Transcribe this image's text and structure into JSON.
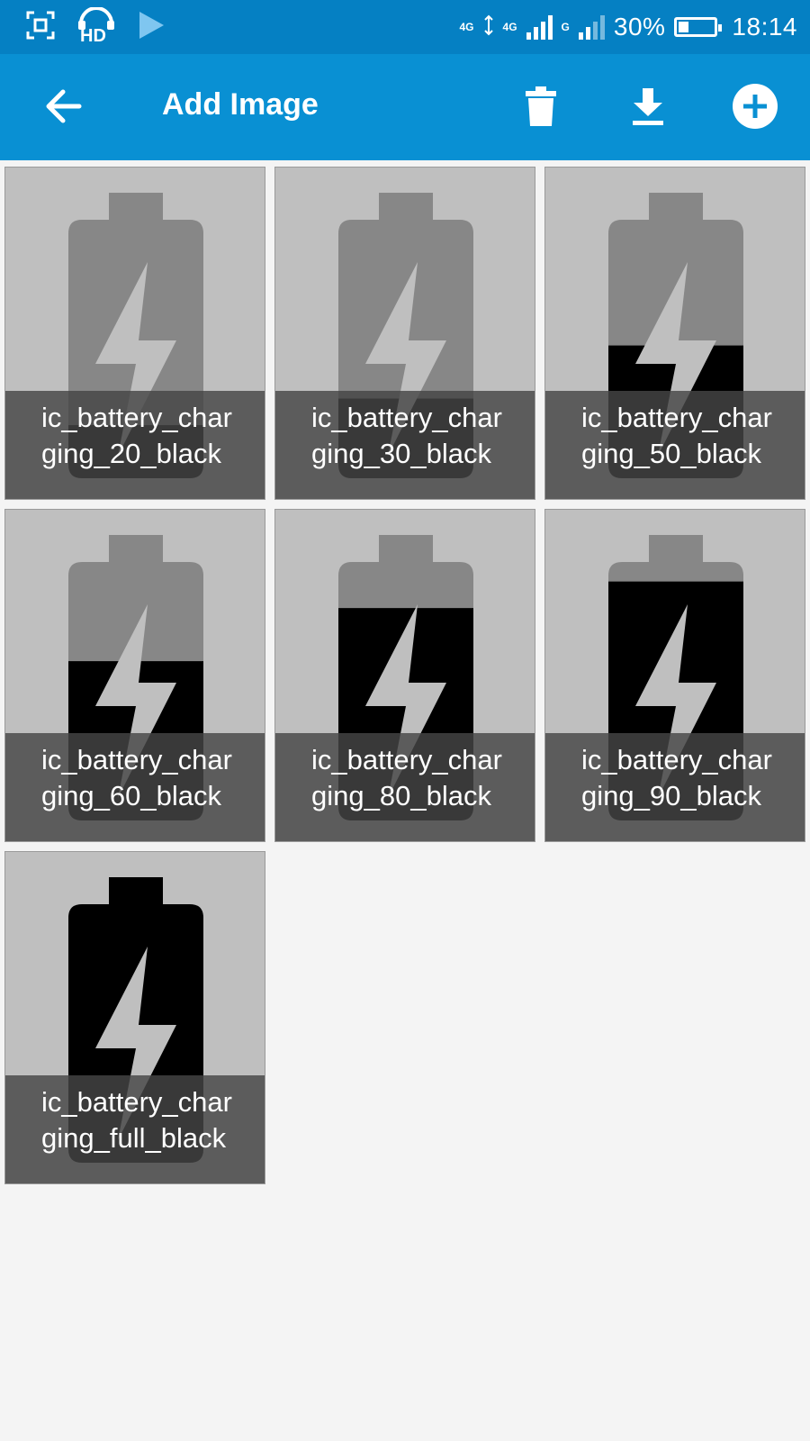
{
  "status_bar": {
    "left_icons": [
      "screenshot-icon",
      "hd-voice-icon",
      "play-store-icon"
    ],
    "network_label_1": "4G",
    "network_label_2": "4G",
    "network_label_3": "G",
    "battery_percent": 30,
    "battery_text": "30%",
    "time": "18:14"
  },
  "app_bar": {
    "title": "Add Image",
    "back_icon": "arrow-back-icon",
    "actions": [
      {
        "name": "delete",
        "icon": "trash-icon"
      },
      {
        "name": "download",
        "icon": "download-icon"
      },
      {
        "name": "add",
        "icon": "add-circle-icon"
      }
    ]
  },
  "images": [
    {
      "label": "ic_battery_charging_20_black",
      "level": 20
    },
    {
      "label": "ic_battery_charging_30_black",
      "level": 30
    },
    {
      "label": "ic_battery_charging_50_black",
      "level": 50
    },
    {
      "label": "ic_battery_charging_60_black",
      "level": 60
    },
    {
      "label": "ic_battery_charging_80_black",
      "level": 80
    },
    {
      "label": "ic_battery_charging_90_black",
      "level": 90
    },
    {
      "label": "ic_battery_charging_full_black",
      "level": 100
    }
  ],
  "colors": {
    "status_bar": "#0580c3",
    "app_bar": "#0990d3",
    "tile_bg": "#bfbfbf",
    "battery_empty": "#878787",
    "battery_full": "#000000",
    "bolt": "#bfbfbf"
  }
}
